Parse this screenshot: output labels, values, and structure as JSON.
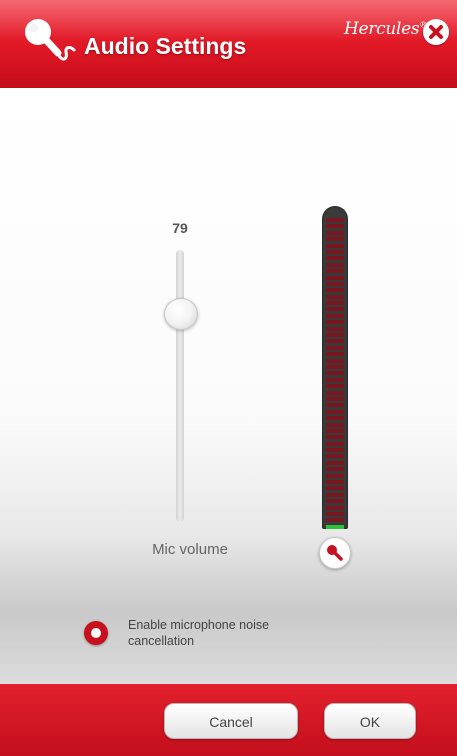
{
  "header": {
    "title": "Audio Settings",
    "brand": "Hercules",
    "brand_mark": "®",
    "title_icon": "microphone-icon",
    "close_icon": "close-icon"
  },
  "mic_volume": {
    "value": "79",
    "label": "Mic volume"
  },
  "meter": {
    "segments_total": 49,
    "segments_lit": 1,
    "colors": {
      "off": "#7a1620",
      "on": "#29c238"
    },
    "mic_button_icon": "microphone-icon"
  },
  "noise_cancellation": {
    "label": "Enable microphone noise cancellation",
    "checked": true
  },
  "footer": {
    "cancel_label": "Cancel",
    "ok_label": "OK"
  },
  "colors": {
    "brand_red": "#df1725",
    "text_grey": "#666666"
  }
}
